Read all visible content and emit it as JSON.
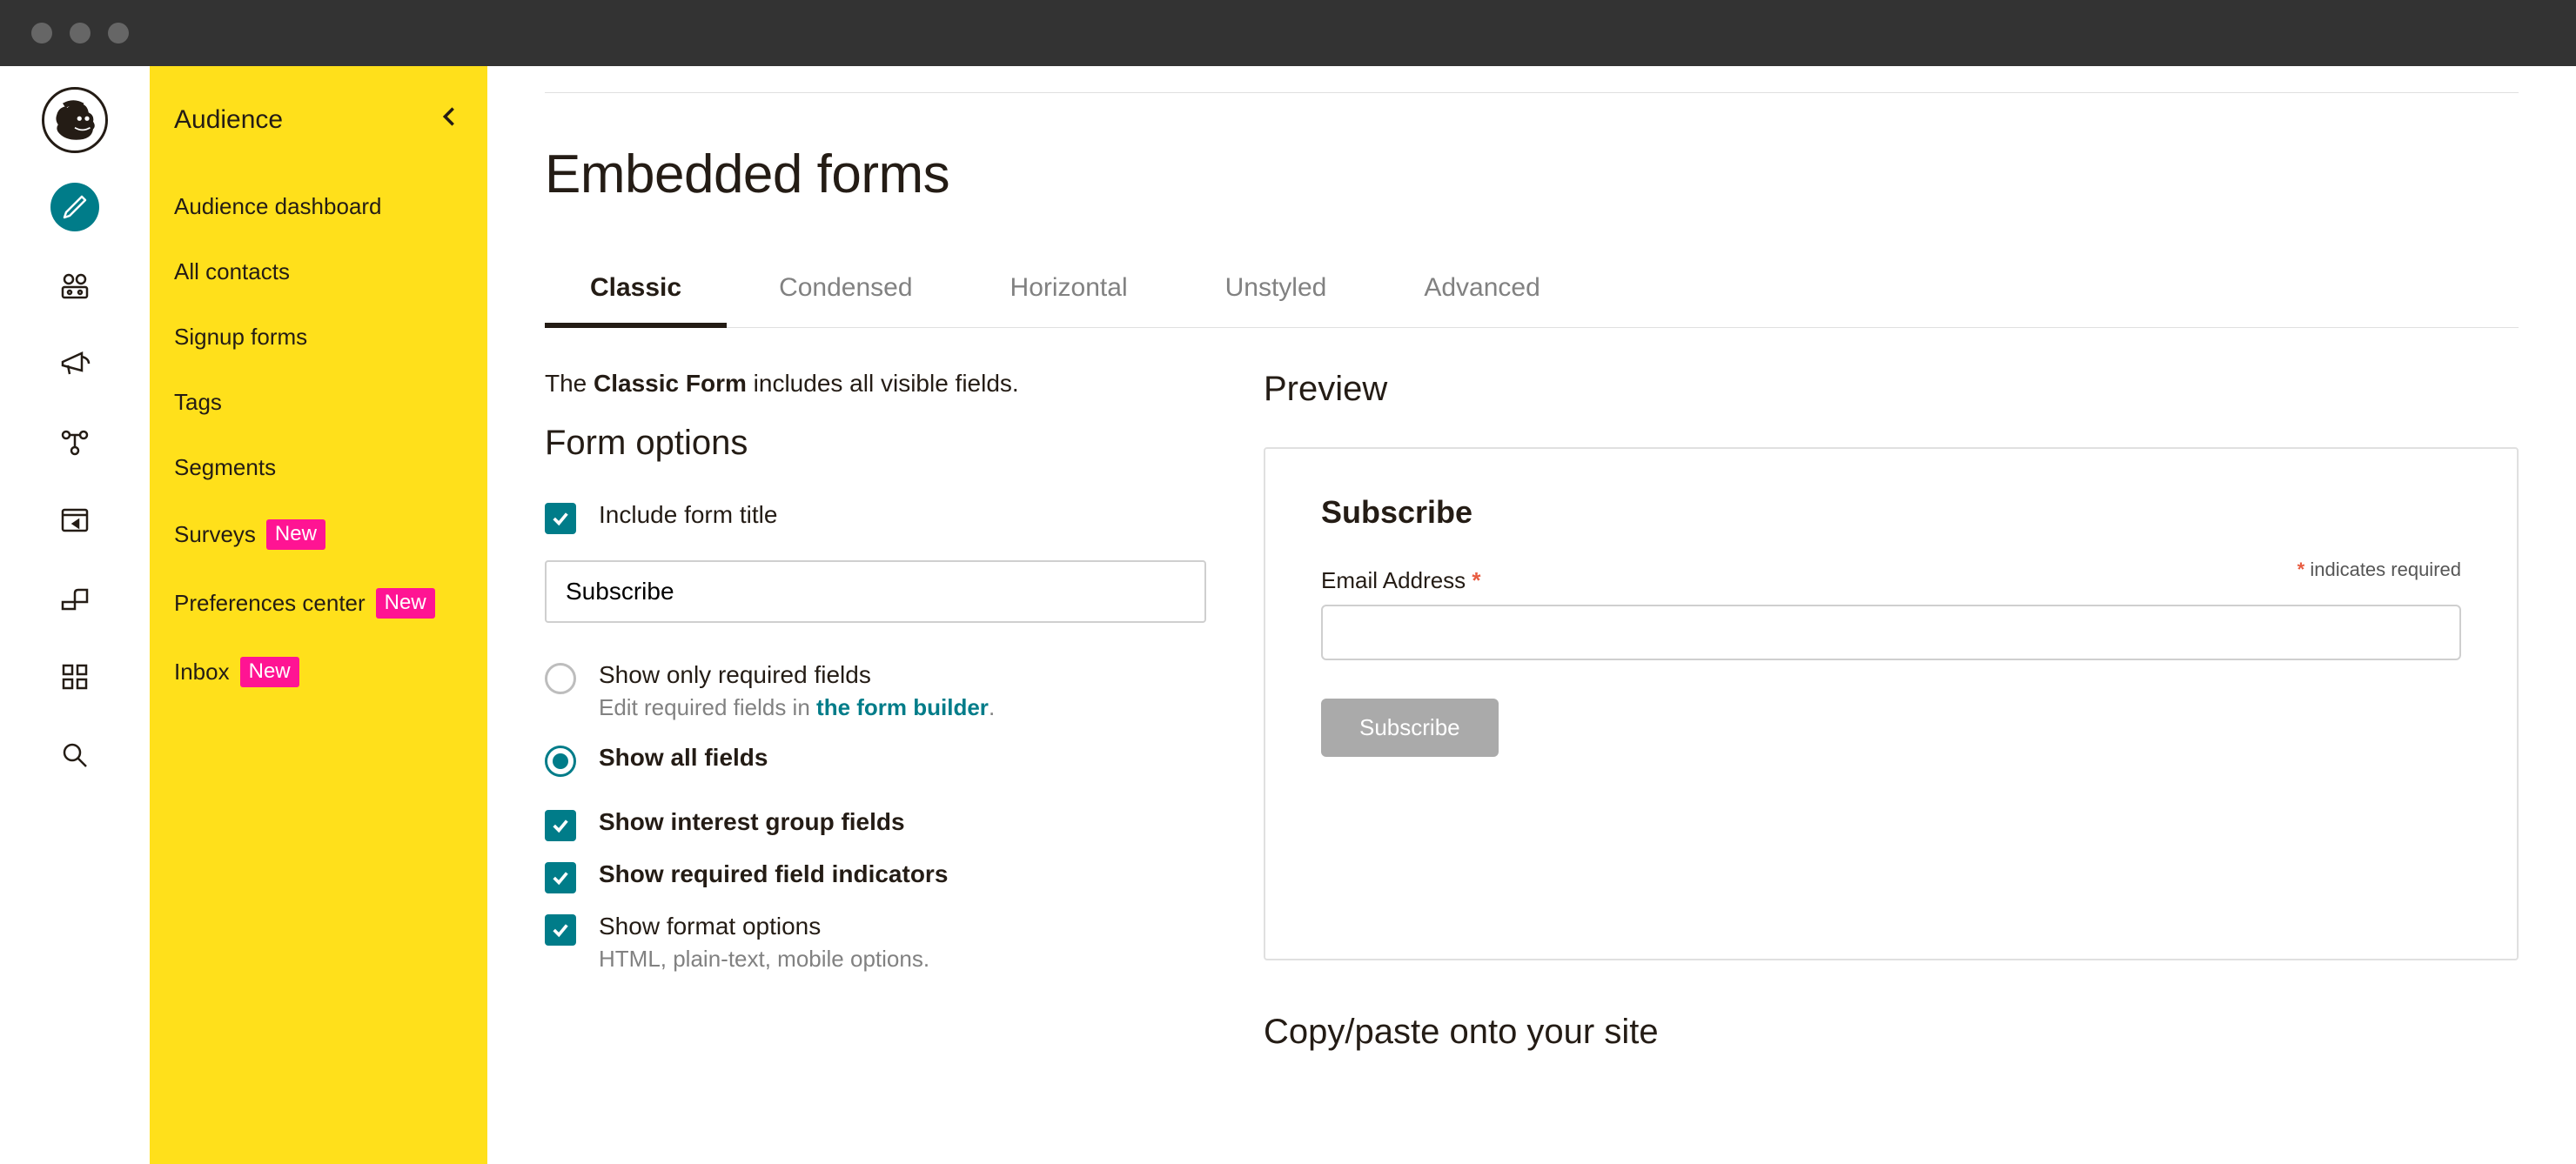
{
  "sidebar": {
    "title": "Audience",
    "items": [
      {
        "label": "Audience dashboard",
        "badge": null
      },
      {
        "label": "All contacts",
        "badge": null
      },
      {
        "label": "Signup forms",
        "badge": null
      },
      {
        "label": "Tags",
        "badge": null
      },
      {
        "label": "Segments",
        "badge": null
      },
      {
        "label": "Surveys",
        "badge": "New"
      },
      {
        "label": "Preferences center",
        "badge": "New"
      },
      {
        "label": "Inbox",
        "badge": "New"
      }
    ]
  },
  "page": {
    "title": "Embedded forms",
    "tabs": [
      "Classic",
      "Condensed",
      "Horizontal",
      "Unstyled",
      "Advanced"
    ],
    "desc_prefix": "The ",
    "desc_bold": "Classic Form",
    "desc_suffix": " includes all visible fields.",
    "section_h": "Form options",
    "include_title_label": "Include form title",
    "title_input_value": "Subscribe",
    "radio_required": "Show only required fields",
    "radio_required_sub_pre": "Edit required fields in ",
    "radio_required_sub_link": "the form builder",
    "radio_all": "Show all fields",
    "cb_interest": "Show interest group fields",
    "cb_required": "Show required field indicators",
    "cb_format": "Show format options",
    "cb_format_sub": "HTML, plain-text, mobile options."
  },
  "preview": {
    "heading": "Preview",
    "form_title": "Subscribe",
    "required_note": " indicates required",
    "email_label": "Email Address ",
    "subscribe_btn": "Subscribe",
    "copy_heading": "Copy/paste onto your site"
  }
}
